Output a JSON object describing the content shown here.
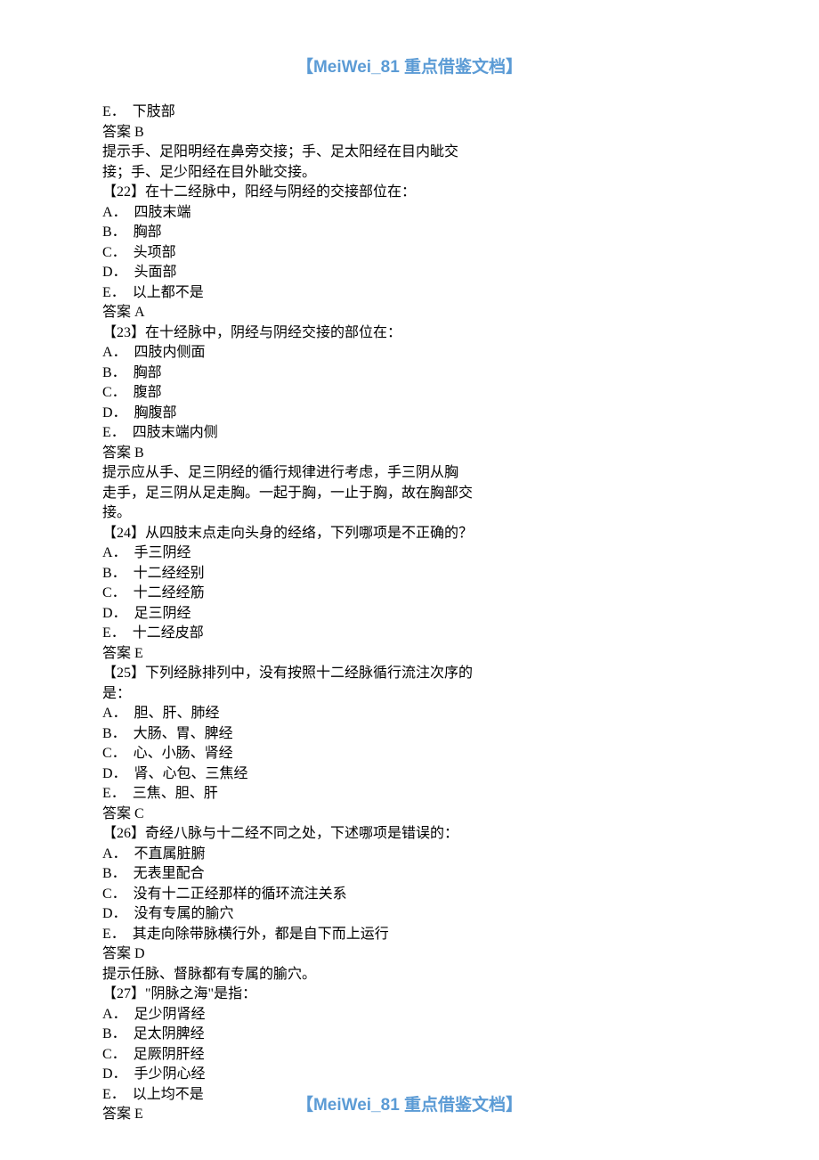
{
  "header": "【MeiWei_81 重点借鉴文档】",
  "footer": "【MeiWei_81 重点借鉴文档】",
  "lines": [
    "E．　下肢部",
    "答案 B",
    "提示手、足阳明经在鼻旁交接；手、足太阳经在目内眦交",
    "接；手、足少阳经在目外眦交接。",
    "【22】在十二经脉中，阳经与阴经的交接部位在：",
    "A．　四肢末端",
    "B．　胸部",
    "C．　头项部",
    "D．　头面部",
    "E．　以上都不是",
    "答案 A",
    "【23】在十经脉中，阴经与阴经交接的部位在：",
    "A．　四肢内侧面",
    "B．　胸部",
    "C．　腹部",
    "D．　胸腹部",
    "E．　四肢末端内侧",
    "答案 B",
    "提示应从手、足三阴经的循行规律进行考虑，手三阴从胸",
    "走手，足三阴从足走胸。一起于胸，一止于胸，故在胸部交",
    "接。",
    "【24】从四肢末点走向头身的经络，下列哪项是不正确的？",
    "A．　手三阴经",
    "B．　十二经经别",
    "C．　十二经经筋",
    "D．　足三阴经",
    "E．　十二经皮部",
    "答案 E",
    "【25】下列经脉排列中，没有按照十二经脉循行流注次序的",
    "是：",
    "A．　胆、肝、肺经",
    "B．　大肠、胃、脾经",
    "C．　心、小肠、肾经",
    "D．　肾、心包、三焦经",
    "E．　三焦、胆、肝",
    "答案 C",
    "【26】奇经八脉与十二经不同之处，下述哪项是错误的：",
    "A．　不直属脏腑",
    "B．　无表里配合",
    "C．　没有十二正经那样的循环流注关系",
    "D．　没有专属的腧穴",
    "E．　其走向除带脉横行外，都是自下而上运行",
    "答案 D",
    "提示任脉、督脉都有专属的腧穴。",
    "【27】\"阴脉之海\"是指：",
    "A．　足少阴肾经",
    "B．　足太阴脾经",
    "C．　足厥阴肝经",
    "D．　手少阴心经",
    "E．　以上均不是",
    "答案 E"
  ]
}
